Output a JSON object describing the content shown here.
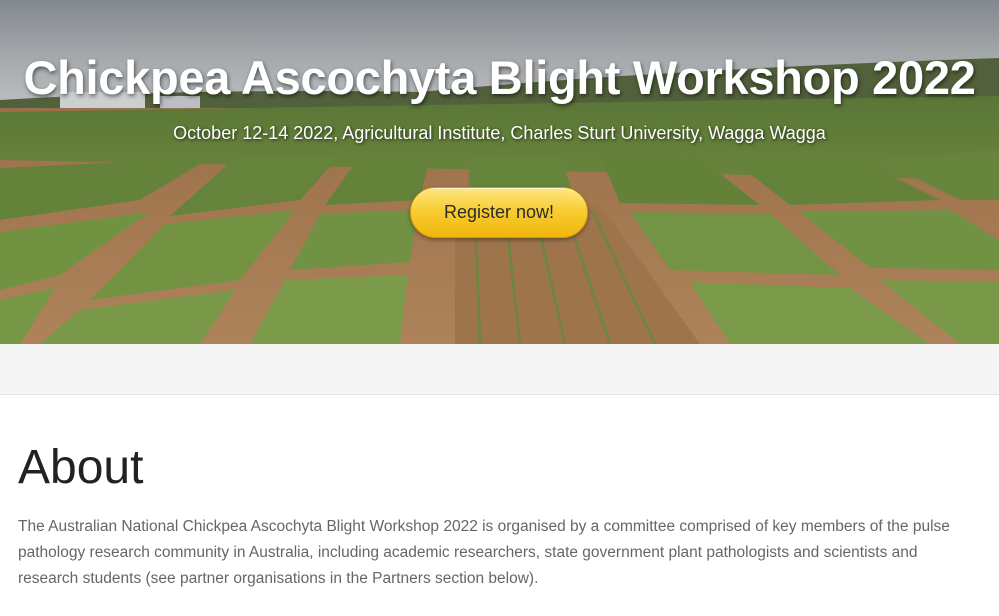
{
  "hero": {
    "title": "Chickpea Ascochyta Blight Workshop 2022",
    "subtitle": "October 12-14 2022, Agricultural Institute, Charles Sturt University, Wagga Wagga",
    "register_label": "Register now!",
    "image_icon": "chickpea-field-photo"
  },
  "about": {
    "heading": "About",
    "text": "The Australian National Chickpea Ascochyta Blight Workshop 2022 is organised by a committee comprised of key members of the pulse pathology research community in Australia, including academic researchers, state government plant pathologists and scientists and research students (see partner organisations in the Partners section below)."
  },
  "colors": {
    "button_yellow": "#f9cd33",
    "heading_text": "#222222",
    "body_text": "#666666",
    "band_grey": "#f5f5f5"
  }
}
